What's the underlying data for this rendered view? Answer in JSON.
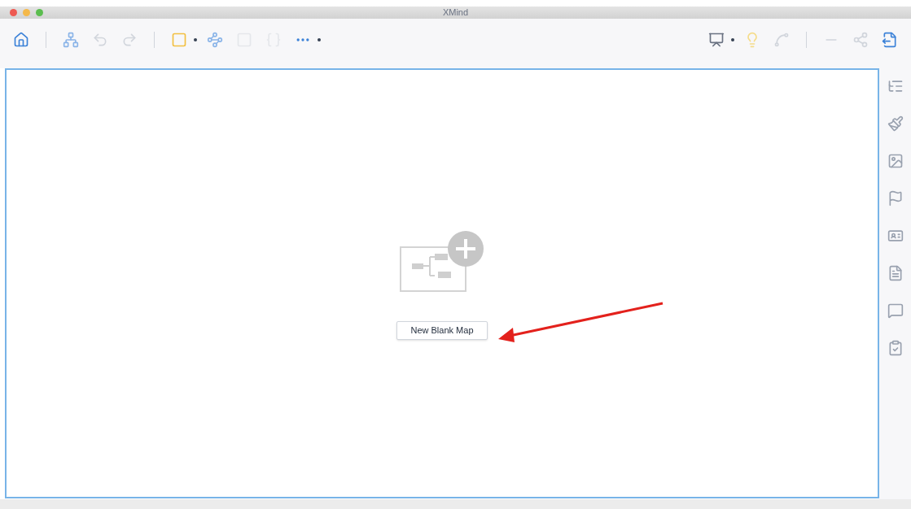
{
  "window": {
    "title": "XMind"
  },
  "canvas": {
    "new_map_button": "New Blank Map"
  }
}
